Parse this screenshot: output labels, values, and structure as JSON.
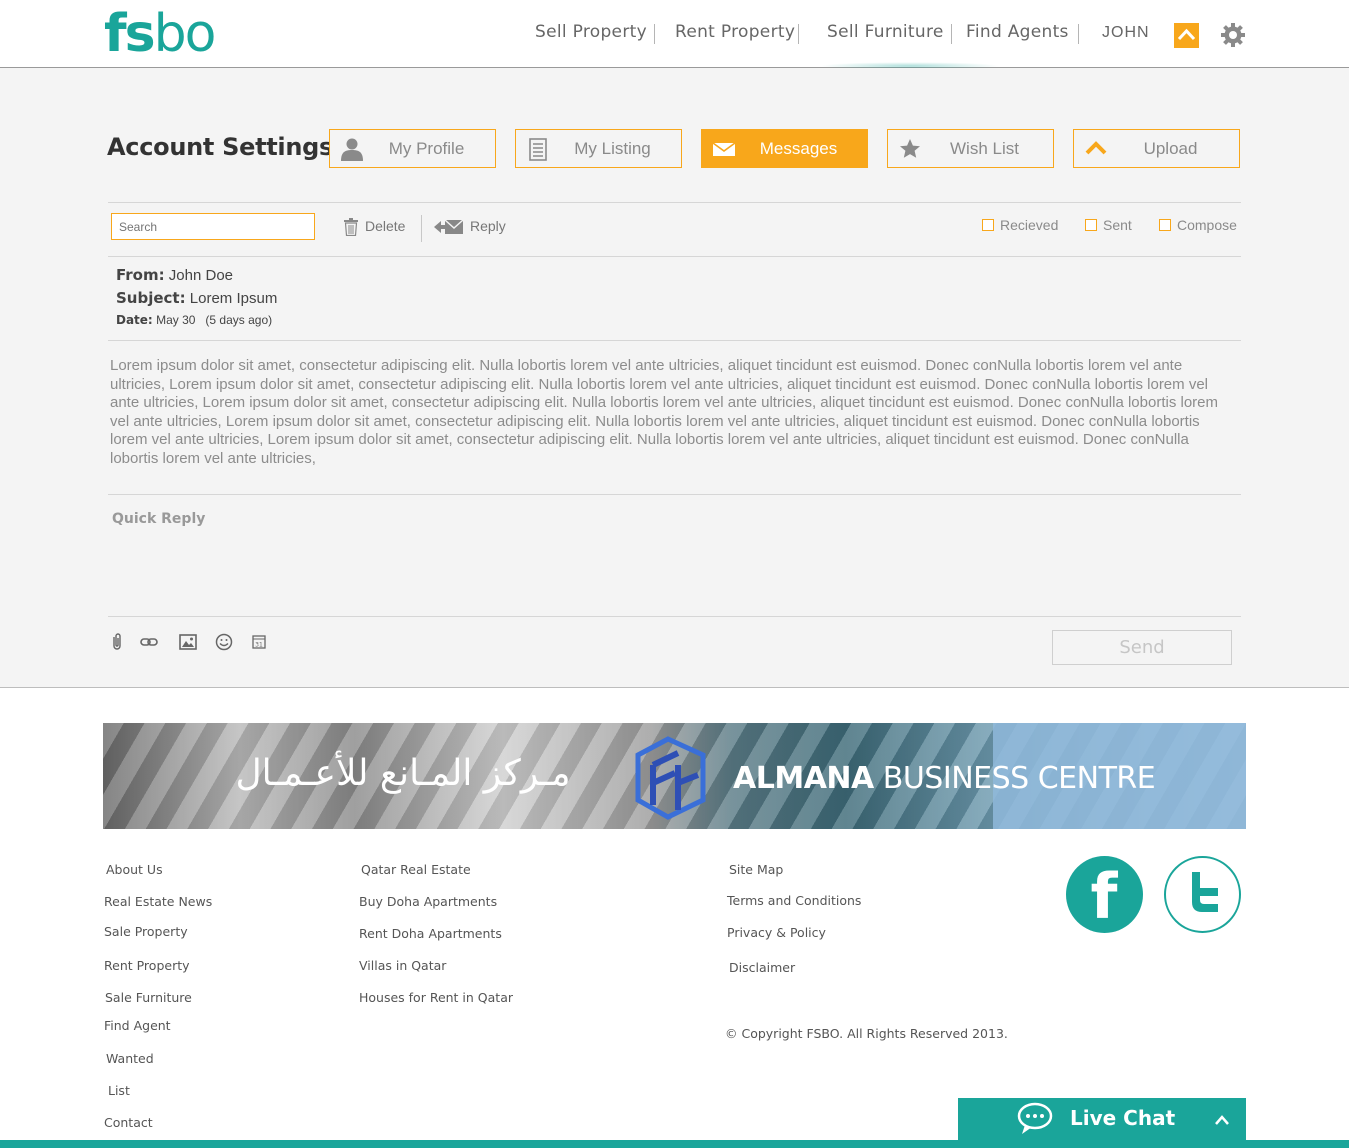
{
  "brand": {
    "logo_fs": "fs",
    "logo_bo": "bo",
    "accent": "#1aa59a",
    "highlight": "#f8a71b"
  },
  "nav": {
    "items": [
      "Sell Property",
      "Rent Property",
      "Sell Furniture",
      "Find Agents"
    ],
    "user": "JOHN"
  },
  "account": {
    "title": "Account Settings",
    "tabs": [
      {
        "label": "My Profile",
        "icon": "user-icon"
      },
      {
        "label": "My Listing",
        "icon": "list-icon"
      },
      {
        "label": "Messages",
        "icon": "envelope-icon",
        "active": true
      },
      {
        "label": "Wish List",
        "icon": "star-icon"
      },
      {
        "label": "Upload",
        "icon": "upload-icon"
      }
    ]
  },
  "toolbar": {
    "search_placeholder": "Search",
    "delete_label": "Delete",
    "reply_label": "Reply",
    "filters": [
      "Recieved",
      "Sent",
      "Compose"
    ]
  },
  "message": {
    "from_label": "From:",
    "from": "John Doe",
    "subject_label": "Subject:",
    "subject": "Lorem Ipsum",
    "date_label": "Date:",
    "date": "May 30   (5 days ago)",
    "body": "Lorem ipsum dolor sit amet, consectetur adipiscing elit. Nulla lobortis lorem vel ante ultricies, aliquet tincidunt est euismod. Donec conNulla lobortis lorem vel ante ultricies,     Lorem ipsum dolor sit amet, consectetur adipiscing elit. Nulla lobortis lorem vel ante ultricies, aliquet tincidunt est euismod. Donec conNulla lobortis lorem vel ante ultricies,     Lorem ipsum dolor sit amet, consectetur adipiscing elit. Nulla lobortis lorem vel ante ultricies, aliquet tincidunt est euismod. Donec conNulla lobortis lorem vel ante ultricies,     Lorem ipsum dolor sit amet, consectetur adipiscing elit. Nulla lobortis lorem vel ante ultricies, aliquet tincidunt est euismod. Donec conNulla lobortis lorem vel ante ultricies,     Lorem ipsum dolor sit amet, consectetur adipiscing elit. Nulla lobortis lorem vel ante ultricies, aliquet tincidunt est euismod. Donec conNulla lobortis lorem vel ante ultricies,"
  },
  "reply": {
    "quick_label": "Quick Reply",
    "format_icons": [
      "attachment-icon",
      "link-icon",
      "image-icon",
      "emoji-icon",
      "calendar-icon"
    ],
    "send_label": "Send"
  },
  "banner": {
    "arabic": "مـركز المـانع للأعـمـال",
    "name_bold": "ALMANA",
    "name_rest": " BUSINESS CENTRE"
  },
  "footer": {
    "col1": [
      "About Us",
      "Real Estate News",
      "Sale Property",
      "Rent Property",
      "Sale Furniture",
      "Find Agent",
      "Wanted",
      "List",
      "Contact"
    ],
    "col2": [
      "Qatar Real Estate",
      "Buy Doha Apartments",
      "Rent Doha Apartments",
      "Villas in Qatar",
      "Houses for Rent in Qatar"
    ],
    "col3": [
      "Site Map",
      "Terms and Conditions",
      "Privacy & Policy",
      "Disclaimer"
    ],
    "copyright": "© Copyright FSBO. All Rights Reserved 2013.",
    "social": [
      "facebook-icon",
      "twitter-icon"
    ]
  },
  "livechat": {
    "label": "Live Chat"
  }
}
